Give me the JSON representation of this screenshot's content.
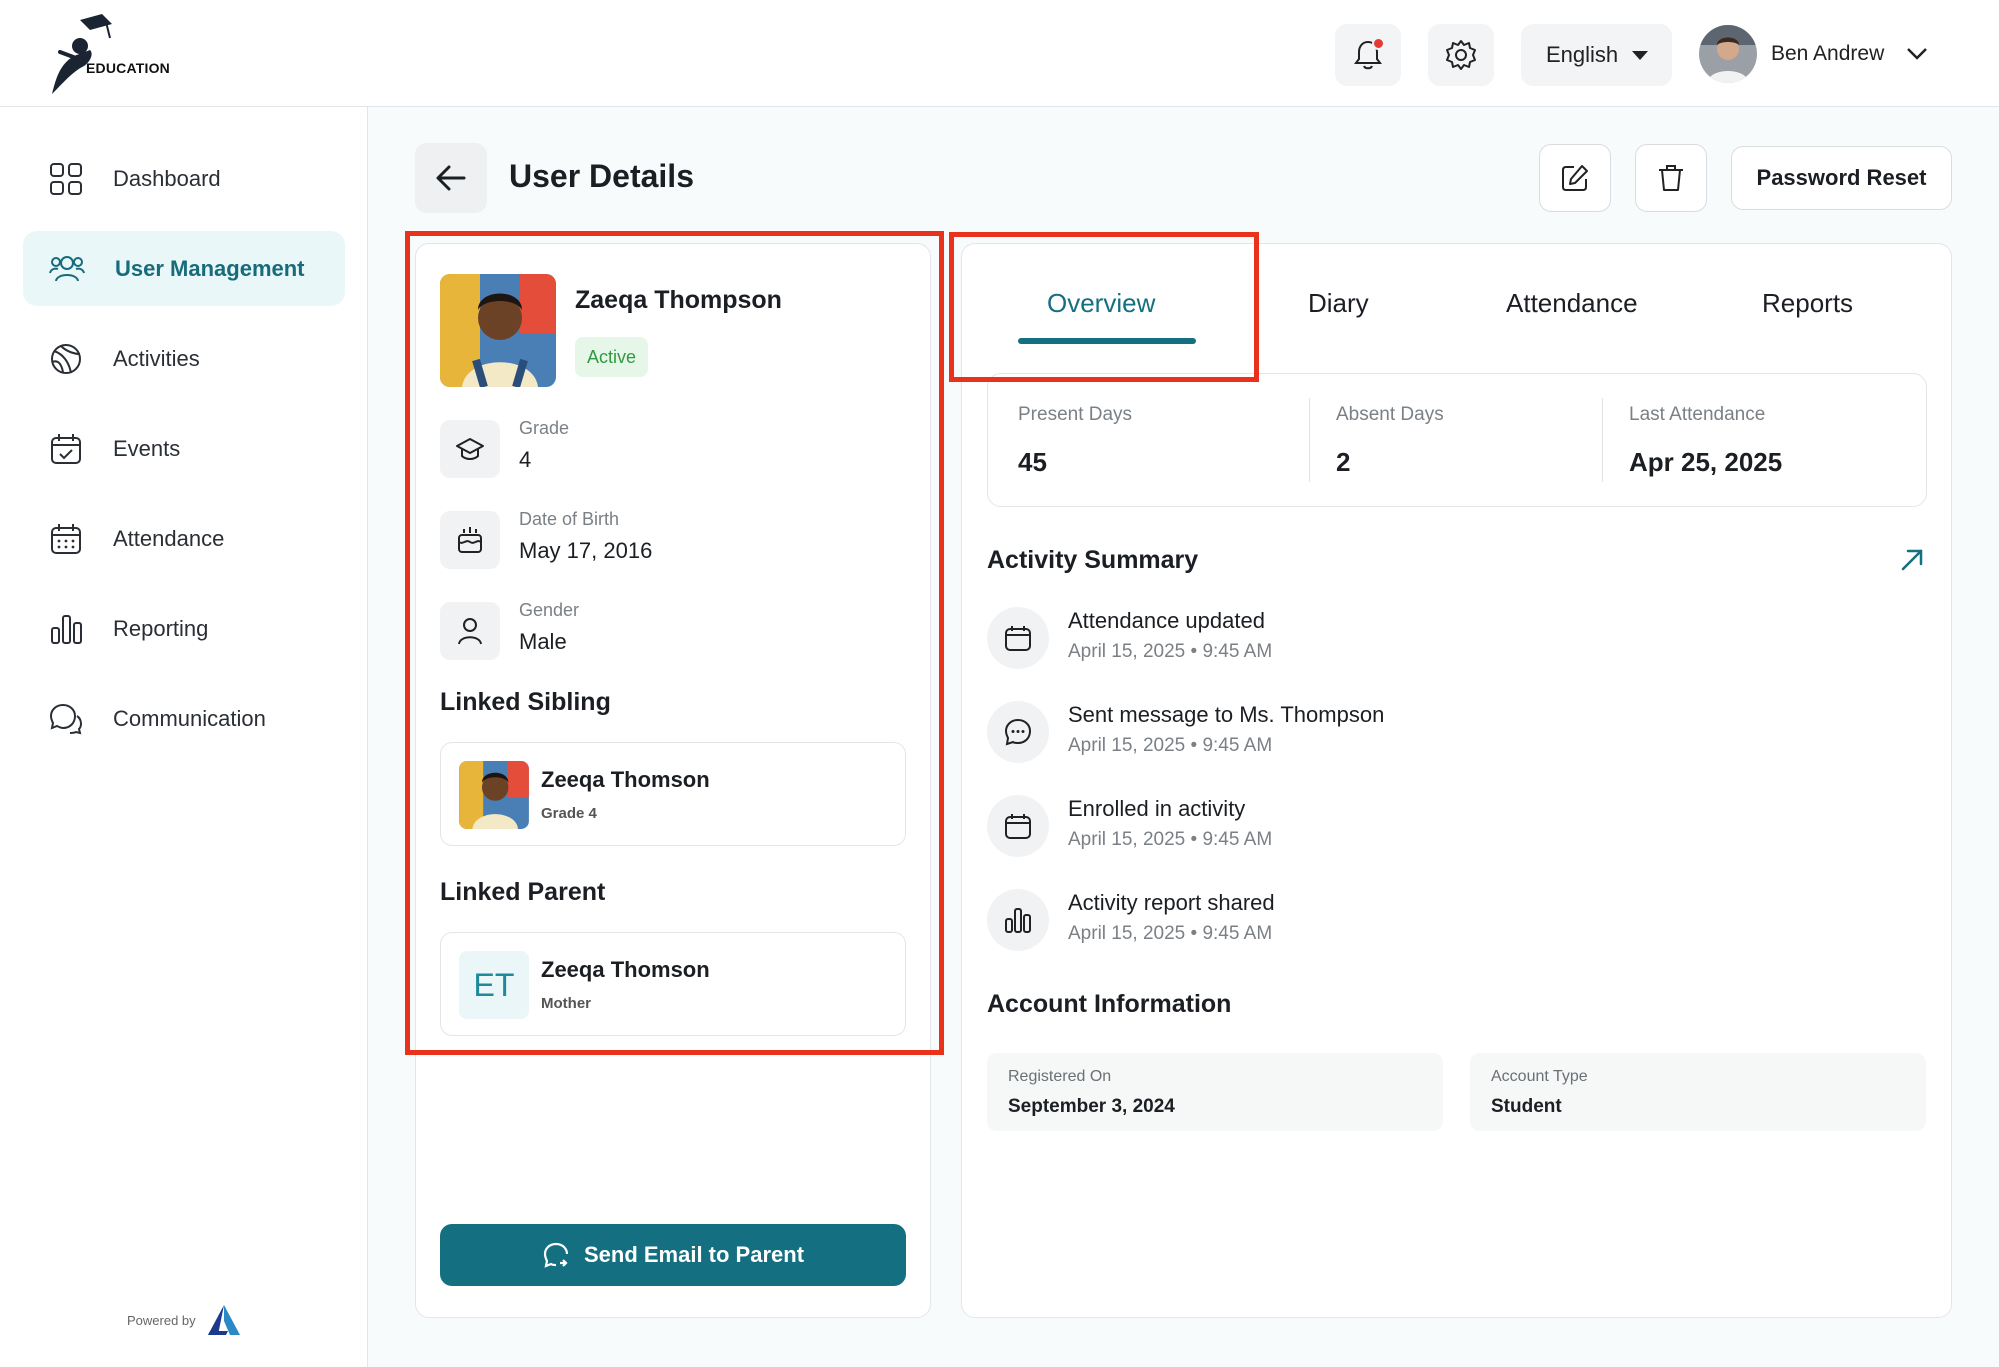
{
  "header": {
    "logo_text": "EDUCATION",
    "language": "English",
    "user_name": "Ben Andrew",
    "notification_icon": "bell-icon",
    "settings_icon": "gear-icon"
  },
  "sidebar": {
    "items": [
      {
        "label": "Dashboard",
        "icon": "grid-icon"
      },
      {
        "label": "User Management",
        "icon": "users-icon",
        "active": true
      },
      {
        "label": "Activities",
        "icon": "ball-icon"
      },
      {
        "label": "Events",
        "icon": "calendar-check-icon"
      },
      {
        "label": "Attendance",
        "icon": "calendar-icon"
      },
      {
        "label": "Reporting",
        "icon": "bar-chart-icon"
      },
      {
        "label": "Communication",
        "icon": "chat-icon"
      }
    ],
    "powered_by": "Powered by"
  },
  "page": {
    "title": "User Details",
    "password_reset": "Password Reset"
  },
  "profile": {
    "name": "Zaeqa Thompson",
    "status": "Active",
    "grade_label": "Grade",
    "grade_value": "4",
    "dob_label": "Date of Birth",
    "dob_value": "May 17, 2016",
    "gender_label": "Gender",
    "gender_value": "Male",
    "linked_sibling_title": "Linked Sibling",
    "sibling": {
      "name": "Zeeqa Thomson",
      "sub": "Grade 4"
    },
    "linked_parent_title": "Linked Parent",
    "parent": {
      "initials": "ET",
      "name": "Zeeqa Thomson",
      "sub": "Mother"
    },
    "send_email": "Send Email to Parent"
  },
  "tabs": [
    "Overview",
    "Diary",
    "Attendance",
    "Reports"
  ],
  "stats": [
    {
      "label": "Present Days",
      "value": "45"
    },
    {
      "label": "Absent Days",
      "value": "2"
    },
    {
      "label": "Last Attendance",
      "value": "Apr 25, 2025"
    }
  ],
  "activity_summary": {
    "title": "Activity Summary",
    "items": [
      {
        "title": "Attendance updated",
        "time": "April 15, 2025 • 9:45 AM",
        "icon": "calendar-icon"
      },
      {
        "title": "Sent message to Ms. Thompson",
        "time": "April 15, 2025 • 9:45 AM",
        "icon": "message-icon"
      },
      {
        "title": "Enrolled in activity",
        "time": "April 15, 2025 • 9:45 AM",
        "icon": "calendar-icon"
      },
      {
        "title": "Activity report shared",
        "time": "April 15, 2025 • 9:45 AM",
        "icon": "bar-chart-icon"
      }
    ]
  },
  "account": {
    "title": "Account Information",
    "registered_label": "Registered On",
    "registered_value": "September 3, 2024",
    "type_label": "Account Type",
    "type_value": "Student"
  },
  "colors": {
    "primary": "#146f80",
    "active_nav_bg": "#e9f7f8",
    "highlight": "#e8321c",
    "status_green": "#2f9a3e"
  }
}
